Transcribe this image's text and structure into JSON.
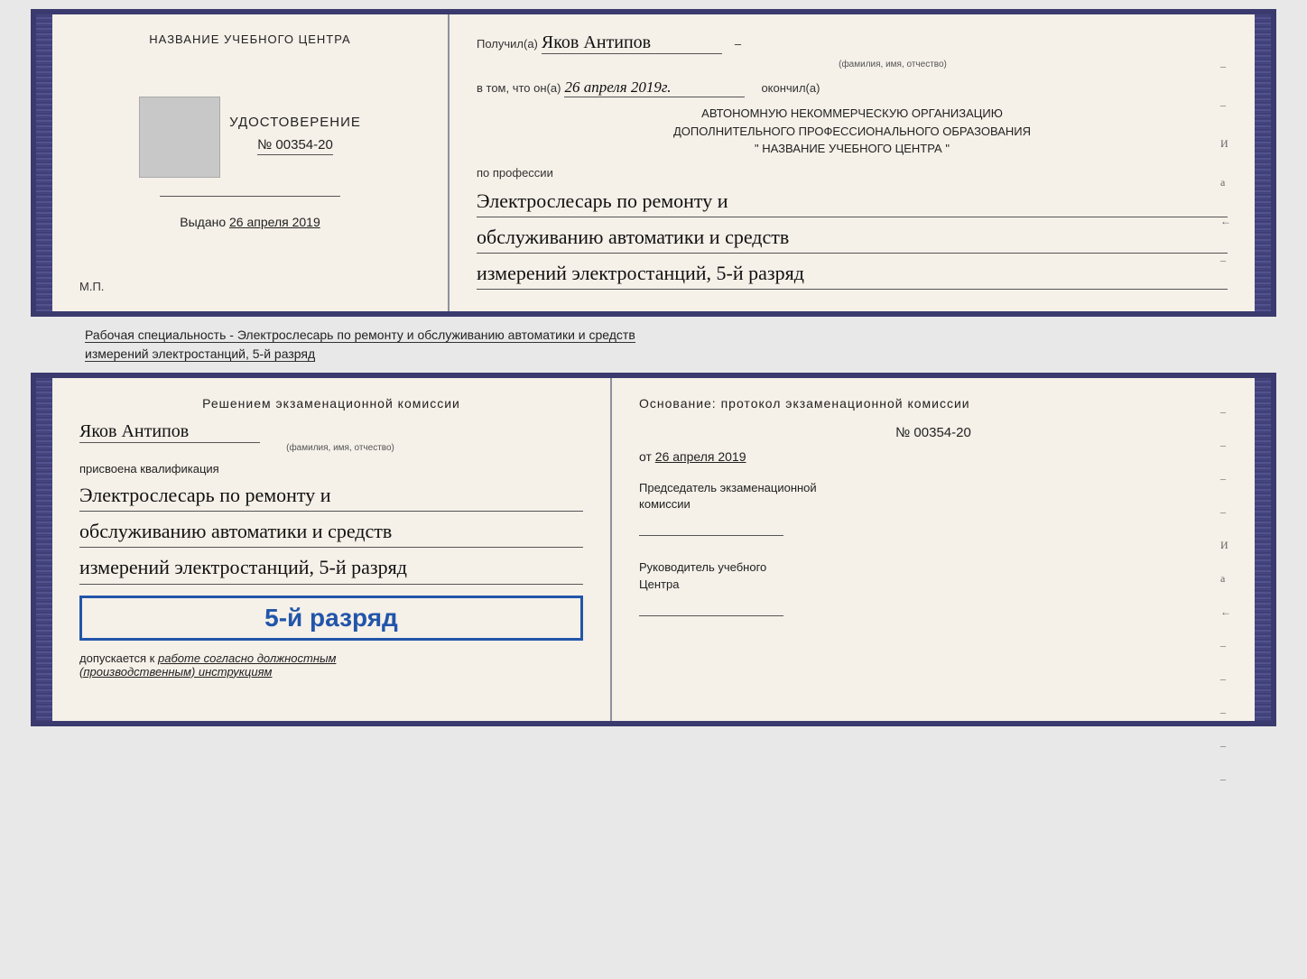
{
  "top_book": {
    "left": {
      "title": "НАЗВАНИЕ УЧЕБНОГО ЦЕНТРА",
      "udostoverenie": "УДОСТОВЕРЕНИЕ",
      "number": "№ 00354-20",
      "vydano_label": "Выдано",
      "vydano_date": "26 апреля 2019",
      "mp": "М.П."
    },
    "right": {
      "poluchil_label": "Получил(а)",
      "poluchil_name": "Яков Антипов",
      "fio_caption": "(фамилия, имя, отчество)",
      "v_tom_label": "в том, что он(а)",
      "v_tom_date": "26 апреля 2019г.",
      "okonchil_label": "окончил(а)",
      "org_line1": "АВТОНОМНУЮ НЕКОММЕРЧЕСКУЮ ОРГАНИЗАЦИЮ",
      "org_line2": "ДОПОЛНИТЕЛЬНОГО ПРОФЕССИОНАЛЬНОГО ОБРАЗОВАНИЯ",
      "org_name": "\"   НАЗВАНИЕ УЧЕБНОГО ЦЕНТРА   \"",
      "po_professii": "по профессии",
      "profession_line1": "Электрослесарь по ремонту и",
      "profession_line2": "обслуживанию автоматики и средств",
      "profession_line3": "измерений электростанций, 5-й разряд",
      "side_labels": [
        "–",
        "–",
        "И",
        "а",
        "←",
        "–"
      ]
    }
  },
  "subtitle": {
    "line1": "Рабочая специальность - Электрослесарь по ремонту и обслуживанию автоматики и средств",
    "line2": "измерений электростанций, 5-й разряд"
  },
  "bottom_book": {
    "left": {
      "resheniem": "Решением экзаменационной комиссии",
      "name": "Яков Антипов",
      "fio_caption": "(фамилия, имя, отчество)",
      "prisvoena": "присвоена квалификация",
      "prof_line1": "Электрослесарь по ремонту и",
      "prof_line2": "обслуживанию автоматики и средств",
      "prof_line3": "измерений электростанций, 5-й разряд",
      "grade": "5-й разряд",
      "dopuskaetsya": "допускается к",
      "dopusk_italic": "работе согласно должностным",
      "dopusk_italic2": "(производственным) инструкциям"
    },
    "right": {
      "osnovaniye": "Основание: протокол экзаменационной комиссии",
      "number": "№ 00354-20",
      "ot_label": "от",
      "ot_date": "26 апреля 2019",
      "predsedatel_label": "Председатель экзаменационной",
      "predsedatel_label2": "комиссии",
      "rukovoditel_label": "Руководитель учебного",
      "rukovoditel_label2": "Центра",
      "side_labels": [
        "–",
        "–",
        "–",
        "–",
        "И",
        "а",
        "←",
        "–",
        "–",
        "–",
        "–",
        "–"
      ]
    }
  }
}
